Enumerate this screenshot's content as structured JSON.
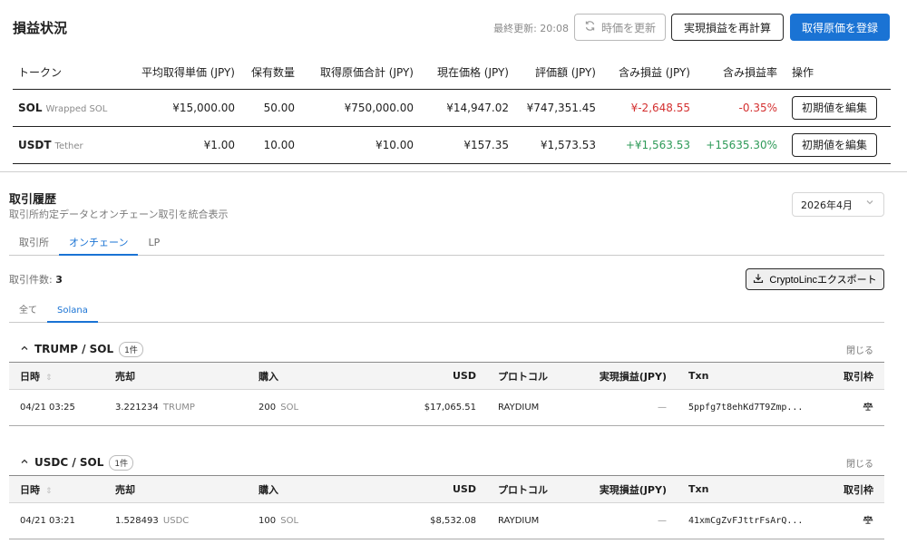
{
  "pl": {
    "title": "損益状況",
    "last_updated": "最終更新: 20:08",
    "refresh_label": "時価を更新",
    "recalc_label": "実現損益を再計算",
    "register_label": "取得原価を登録",
    "columns": [
      "トークン",
      "平均取得単価 (JPY)",
      "保有数量",
      "取得原価合計 (JPY)",
      "現在価格 (JPY)",
      "評価額 (JPY)",
      "含み損益 (JPY)",
      "含み損益率",
      "操作"
    ],
    "rows": [
      {
        "symbol": "SOL",
        "name": "Wrapped SOL",
        "avg_cost": "¥15,000.00",
        "qty": "50.00",
        "total_cost": "¥750,000.00",
        "price": "¥14,947.02",
        "value": "¥747,351.45",
        "pnl": "¥-2,648.55",
        "pnl_rate": "-0.35%",
        "action": "初期値を編集",
        "pnl_color": "#d43030"
      },
      {
        "symbol": "USDT",
        "name": "Tether",
        "avg_cost": "¥1.00",
        "qty": "10.00",
        "total_cost": "¥10.00",
        "price": "¥157.35",
        "value": "¥1,573.53",
        "pnl": "+¥1,563.53",
        "pnl_rate": "+15635.30%",
        "action": "初期値を編集",
        "pnl_color": "#2e9a58"
      }
    ]
  },
  "history": {
    "title": "取引履歴",
    "subtitle": "取引所約定データとオンチェーン取引を統合表示",
    "month": "2026年4月",
    "tabs": [
      "取引所",
      "オンチェーン",
      "LP"
    ],
    "active_tab": "オンチェーン",
    "count_label": "取引件数:",
    "count_value": "3",
    "export_label": "CryptoLincエクスポート",
    "subtabs": [
      "全て",
      "Solana"
    ],
    "active_subtab": "Solana",
    "columns": [
      "日時",
      "売却",
      "購入",
      "USD",
      "プロトコル",
      "実現損益(JPY)",
      "Txn",
      "取引枠"
    ],
    "close_label": "閉じる",
    "groups": [
      {
        "pair": "TRUMP / SOL",
        "badge": "1件",
        "rows": [
          {
            "datetime": "04/21 03:25",
            "sell_amount": "3.221234",
            "sell_token": "TRUMP",
            "buy_amount": "200",
            "buy_token": "SOL",
            "usd": "$17,065.51",
            "protocol": "RAYDIUM",
            "realized": "—",
            "txn": "5ppfg7t8ehKd7T9Zmp..."
          }
        ]
      },
      {
        "pair": "USDC / SOL",
        "badge": "1件",
        "rows": [
          {
            "datetime": "04/21 03:21",
            "sell_amount": "1.528493",
            "sell_token": "USDC",
            "buy_amount": "100",
            "buy_token": "SOL",
            "usd": "$8,532.08",
            "protocol": "RAYDIUM",
            "realized": "—",
            "txn": "41xmCgZvFJttrFsArQ..."
          }
        ]
      }
    ]
  },
  "colors": {
    "accent": "#1a73d4",
    "negative": "#d43030",
    "positive": "#2e9a58"
  },
  "icons": {
    "refresh": "refresh-icon",
    "download": "download-icon",
    "external": "external-link-icon",
    "scale": "scale-icon",
    "chevron": "chevron-down-icon"
  }
}
